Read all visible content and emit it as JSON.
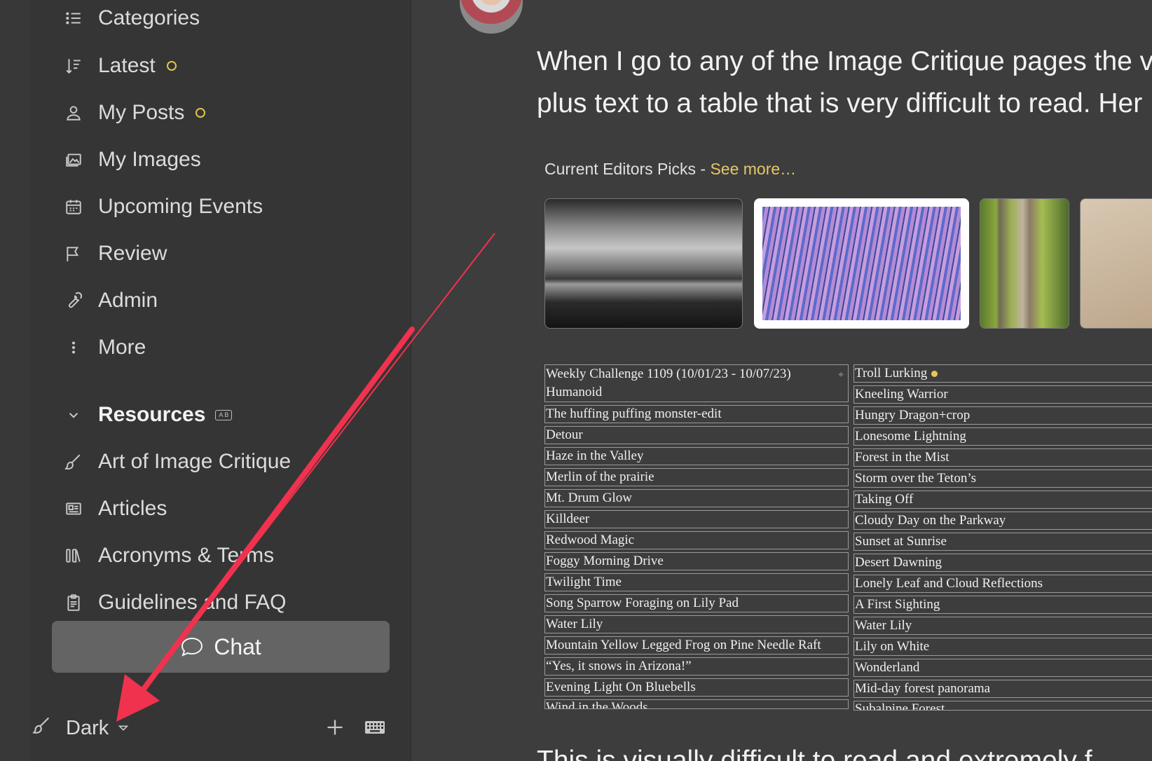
{
  "sidebar": {
    "nav": [
      {
        "label": "Categories",
        "icon": "list-icon",
        "top": 0
      },
      {
        "label": "Latest",
        "icon": "sort-icon",
        "unread": true
      },
      {
        "label": "My Posts",
        "icon": "user-icon",
        "unread": true
      },
      {
        "label": "My Images",
        "icon": "images-icon"
      },
      {
        "label": "Upcoming Events",
        "icon": "calendar-icon"
      },
      {
        "label": "Review",
        "icon": "flag-icon"
      },
      {
        "label": "Admin",
        "icon": "wrench-icon"
      },
      {
        "label": "More",
        "icon": "ellipsis-vertical-icon"
      }
    ],
    "resources": {
      "title": "Resources",
      "items": [
        {
          "label": "Art of Image Critique",
          "icon": "brush-icon"
        },
        {
          "label": "Articles",
          "icon": "newspaper-icon"
        },
        {
          "label": "Acronyms & Terms",
          "icon": "books-icon"
        },
        {
          "label": "Guidelines and FAQ",
          "icon": "clipboard-icon"
        }
      ]
    },
    "chat_label": "Chat",
    "theme_label": "Dark"
  },
  "post": {
    "line1": "When I go to any of the Image Critique pages the vi",
    "line2": "plus text to a table that is very difficult to read. Her",
    "next_line": "This is visually difficult to read and extremely f"
  },
  "screenshot": {
    "picks_title": "Current Editors Picks - ",
    "picks_more": "See more…",
    "left_topics": [
      "Weekly Challenge 1109 (10/01/23 - 10/07/23) Humanoid",
      "The huffing puffing monster-edit",
      "Detour",
      "Haze in the Valley",
      "Merlin of the prairie",
      "Mt. Drum Glow",
      "Killdeer",
      "Redwood Magic",
      "Foggy Morning Drive",
      "Twilight Time",
      "Song Sparrow Foraging on Lily Pad",
      "Water Lily",
      "Mountain Yellow Legged Frog on Pine Needle Raft",
      "“Yes, it snows in Arizona!”",
      "Evening Light On Bluebells",
      "Wind in the Woods"
    ],
    "right_topics": [
      "Troll Lurking",
      "Kneeling Warrior",
      "Hungry Dragon+crop",
      "Lonesome Lightning",
      "Forest in the Mist",
      "Storm over the Teton’s",
      "Taking Off",
      "Cloudy Day on the Parkway",
      "Sunset at Sunrise",
      "Desert Dawning",
      "Lonely Leaf and Cloud Reflections",
      "A First Sighting",
      "Water Lily",
      "Lily on White",
      "Wonderland",
      "Mid-day forest panorama",
      "Subalpine Forest"
    ]
  },
  "colors": {
    "accent": "#e2c34a",
    "arrow": "#f0324f"
  }
}
